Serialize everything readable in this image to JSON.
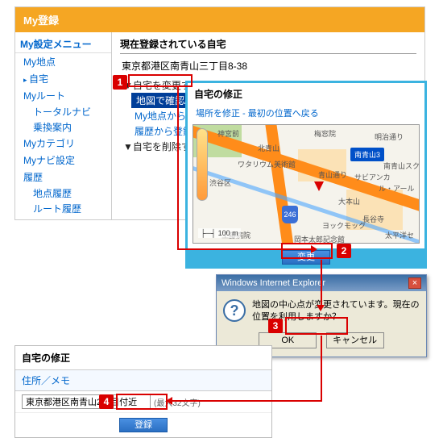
{
  "panel1": {
    "header": "My登録",
    "sidebar": {
      "menu_title": "My設定メニュー",
      "items": [
        {
          "label": "My地点",
          "type": "item"
        },
        {
          "label": "自宅",
          "type": "item",
          "bullet": true
        },
        {
          "label": "Myルート",
          "type": "item"
        },
        {
          "label": "トータルナビ",
          "type": "sub"
        },
        {
          "label": "乗換案内",
          "type": "sub"
        },
        {
          "label": "Myカテゴリ",
          "type": "item"
        },
        {
          "label": "Myナビ設定",
          "type": "item"
        },
        {
          "label": "履歴",
          "type": "item"
        },
        {
          "label": "地点履歴",
          "type": "sub"
        },
        {
          "label": "ルート履歴",
          "type": "sub"
        }
      ]
    },
    "main": {
      "title": "現在登録されている自宅",
      "address": "東京都港区南青山三丁目8-38",
      "options": [
        "▼自宅を変更する",
        "地図で確認/登録",
        "My地点から登録",
        "履歴から登録",
        "▼自宅を削除する"
      ],
      "selected_option_index": 1
    }
  },
  "panel2": {
    "title": "自宅の修正",
    "link": "場所を修正 - 最初の位置へ戻る",
    "map": {
      "scale": "100 m",
      "route_shield": "246",
      "labels": [
        "神宮前",
        "明治通り",
        "梅窓院",
        "南青山3",
        "渋谷区",
        "北青山",
        "青山通り",
        "長谷寺",
        "ル・アール",
        "南青山スクエア",
        "サビアンカ",
        "大本山",
        "太平洋セ",
        "ワタリウム美術館",
        "岡本太郎記念館",
        "ヨックモック",
        "工藤病院"
      ]
    },
    "change_button": "変更"
  },
  "dialog": {
    "title": "Windows Internet Explorer",
    "message": "地図の中心点が変更されています。現在の位置を利用しますか？",
    "ok": "OK",
    "cancel": "キャンセル"
  },
  "panel4": {
    "title": "自宅の修正",
    "subheader": "住所／メモ",
    "input_value": "東京都港区南青山2丁目付近",
    "hint": "(最大32文字)",
    "register_button": "登録"
  },
  "callouts": [
    "1",
    "2",
    "3",
    "4"
  ]
}
